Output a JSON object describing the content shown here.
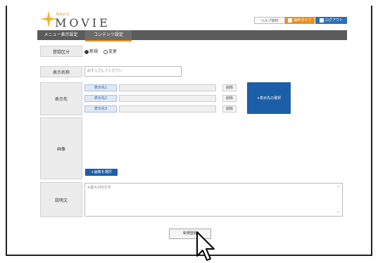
{
  "header": {
    "logo_small": "NAVIC",
    "logo_text": "MOVIE",
    "help_label": "ヘルプ資料",
    "guide_label": "操作ガイド",
    "logout_label": "ログアウト"
  },
  "nav": {
    "tabs": [
      {
        "label": "メニュー表示設定"
      },
      {
        "label": "コンテンツ設定"
      }
    ]
  },
  "form": {
    "registration_type": {
      "label": "登録区分",
      "options": [
        {
          "label": "新規",
          "selected": true
        },
        {
          "label": "変更",
          "selected": false
        }
      ]
    },
    "display_name": {
      "label": "表示名称",
      "placeholder": "必ず入力してください"
    },
    "destination": {
      "label": "表示先",
      "rows": [
        {
          "button": "表示先1",
          "delete": "削除"
        },
        {
          "button": "表示先2",
          "delete": "削除"
        },
        {
          "button": "表示先3",
          "delete": "削除"
        }
      ],
      "select_button": "+表示先の選択"
    },
    "image": {
      "label": "画像",
      "select_button": "+画像を選択"
    },
    "description": {
      "label": "説明文",
      "placeholder": "※最大200文字"
    },
    "submit_label": "新規登録"
  },
  "colors": {
    "accent_orange": "#e8901f",
    "primary_blue": "#1d5ea8",
    "nav_gray": "#5b5b5b"
  }
}
